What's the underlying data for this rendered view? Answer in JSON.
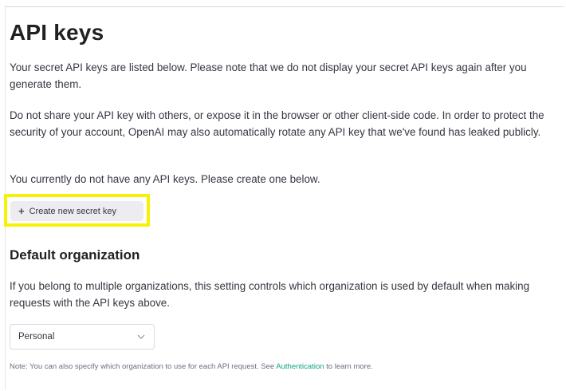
{
  "page": {
    "title": "API keys",
    "intro": "Your secret API keys are listed below. Please note that we do not display your secret API keys again after you generate them.",
    "warning": "Do not share your API key with others, or expose it in the browser or other client-side code. In order to protect the security of your account, OpenAI may also automatically rotate any API key that we've found has leaked publicly.",
    "empty_state": "You currently do not have any API keys. Please create one below.",
    "create_button": {
      "icon": "plus-icon",
      "label": "Create new secret key"
    }
  },
  "default_organization": {
    "heading": "Default organization",
    "description": "If you belong to multiple organizations, this setting controls which organization is used by default when making requests with the API keys above.",
    "select": {
      "value": "Personal",
      "icon": "chevron-down-icon"
    },
    "note": {
      "before_link": "Note: You can also specify which organization to use for each API request. See ",
      "link_text": "Authentication",
      "after_link": " to learn more."
    }
  },
  "colors": {
    "highlight": "#f7f205",
    "link": "#10a37f",
    "button_bg": "#ececf1",
    "text": "#353740"
  }
}
